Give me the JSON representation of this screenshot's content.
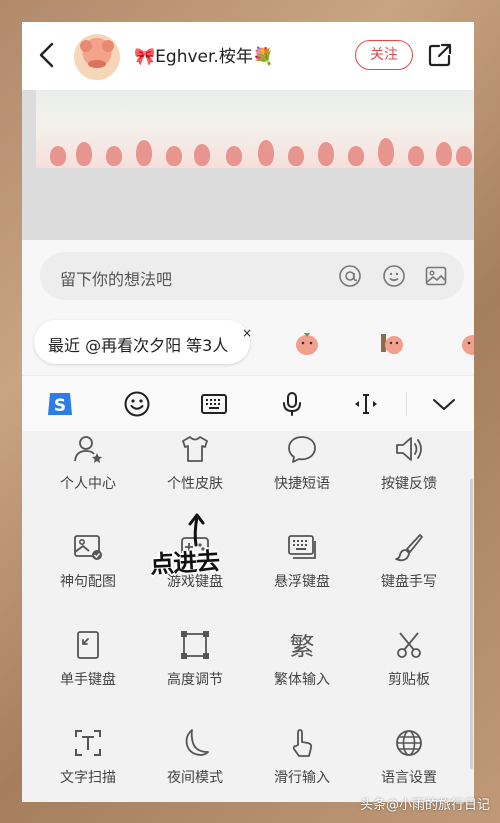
{
  "header": {
    "username": "🎀Eghver.桉年💐",
    "follow_label": "关注"
  },
  "comment": {
    "placeholder": "留下你的想法吧",
    "recent_chip": "最近 @再看次夕阳 等3人",
    "close_glyph": "×"
  },
  "toolbar": {
    "icons": [
      "sogou-logo-icon",
      "emoji-icon",
      "keyboard-icon",
      "microphone-icon",
      "cursor-move-icon",
      "chevron-down-icon"
    ]
  },
  "grid": {
    "items": [
      {
        "label": "个人中心",
        "icon": "user-icon"
      },
      {
        "label": "个性皮肤",
        "icon": "shirt-icon"
      },
      {
        "label": "快捷短语",
        "icon": "chat-bubble-icon"
      },
      {
        "label": "按键反馈",
        "icon": "speaker-icon"
      },
      {
        "label": "神句配图",
        "icon": "image-icon"
      },
      {
        "label": "游戏键盘",
        "icon": "game-keyboard-icon"
      },
      {
        "label": "悬浮键盘",
        "icon": "float-keyboard-icon"
      },
      {
        "label": "键盘手写",
        "icon": "brush-icon"
      },
      {
        "label": "单手键盘",
        "icon": "one-hand-icon"
      },
      {
        "label": "高度调节",
        "icon": "resize-icon"
      },
      {
        "label": "繁体输入",
        "icon": "traditional-char-icon"
      },
      {
        "label": "剪贴板",
        "icon": "scissors-icon"
      },
      {
        "label": "文字扫描",
        "icon": "text-scan-icon"
      },
      {
        "label": "夜间模式",
        "icon": "moon-icon"
      },
      {
        "label": "滑行输入",
        "icon": "swipe-icon"
      },
      {
        "label": "语言设置",
        "icon": "globe-icon"
      }
    ],
    "traditional_glyph": "繁"
  },
  "annotation": "点进去",
  "watermark": "头条@小雨的旅行日记",
  "colors": {
    "accent": "#e14b4b",
    "sogou_blue": "#2b7de9",
    "background": "#f2f2f2"
  }
}
